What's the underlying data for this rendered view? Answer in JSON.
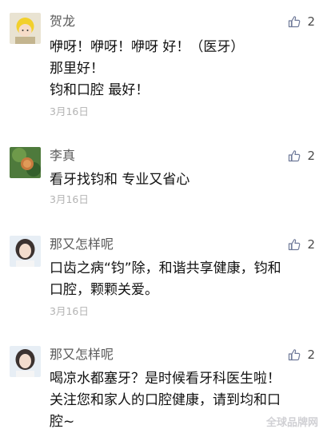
{
  "comments": [
    {
      "user": "贺龙",
      "likes": "2",
      "lines": [
        "咿呀！咿呀！咿呀 好！（医牙）",
        "那里好！",
        "钧和口腔 最好！"
      ],
      "date": "3月16日"
    },
    {
      "user": "李真",
      "likes": "2",
      "lines": [
        "看牙找钧和 专业又省心"
      ],
      "date": "3月16日"
    },
    {
      "user": "那又怎样呢",
      "likes": "2",
      "lines": [
        "口齿之病“钧”除，和谐共享健康，钧和",
        "口腔，颗颗关爱。"
      ],
      "date": "3月16日"
    },
    {
      "user": "那又怎样呢",
      "likes": "2",
      "lines": [
        "喝凉水都塞牙？是时候看牙科医生啦！",
        "关注您和家人的口腔健康，请到均和口",
        "腔~"
      ],
      "date": ""
    }
  ],
  "watermark": "全球品牌网",
  "icons": {
    "like": "thumbs-up-icon"
  },
  "colors": {
    "username": "#5a5a5a",
    "date": "#b3b3b3",
    "text": "#111111"
  }
}
